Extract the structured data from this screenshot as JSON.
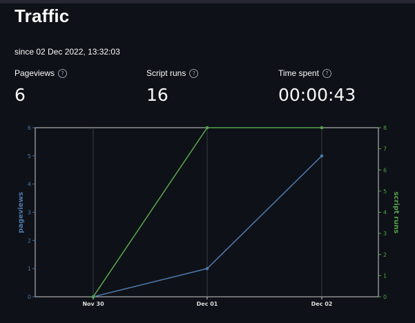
{
  "header": {
    "title": "Traffic",
    "since": "since 02 Dec 2022, 13:32:03"
  },
  "metrics": [
    {
      "label": "Pageviews",
      "value": "6"
    },
    {
      "label": "Script runs",
      "value": "16"
    },
    {
      "label": "Time spent",
      "value": "00:00:43"
    }
  ],
  "help_icon_glyph": "?",
  "chart_data": {
    "type": "line",
    "x": [
      "Nov 30",
      "Dec 01",
      "Dec 02"
    ],
    "series": [
      {
        "name": "pageviews",
        "axis": "left",
        "color": "#4c78a8",
        "values": [
          0,
          1,
          5
        ]
      },
      {
        "name": "script runs",
        "axis": "right",
        "color": "#54a24b",
        "values": [
          0,
          8,
          8
        ]
      }
    ],
    "left_axis": {
      "label": "pageviews",
      "ylim": [
        0,
        6
      ],
      "ticks": [
        "0",
        "1",
        "2",
        "3",
        "4",
        "5",
        "6"
      ]
    },
    "right_axis": {
      "label": "script runs",
      "ylim": [
        0,
        8
      ],
      "ticks": [
        "0",
        "1",
        "2",
        "3",
        "4",
        "5",
        "6",
        "7",
        "8"
      ]
    },
    "grid": "vertical"
  }
}
